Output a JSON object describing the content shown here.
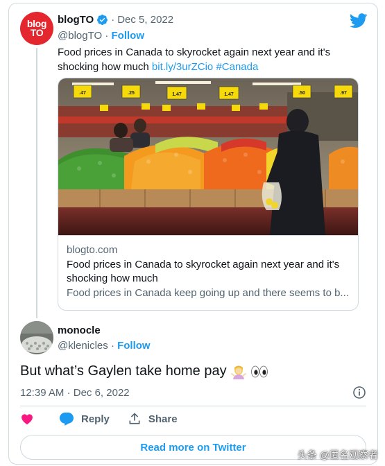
{
  "parent_tweet": {
    "avatar_text_line1": "blog",
    "avatar_text_line2": "TO",
    "display_name": "blogTO",
    "separator": "·",
    "date": "Dec 5, 2022",
    "handle": "@blogTO",
    "follow_label": "Follow",
    "text": "Food prices in Canada to skyrocket again next year and it's shocking how much ",
    "link_text": "bit.ly/3urZCio",
    "hashtag": "#Canada",
    "verified_icon": "verified-badge-icon"
  },
  "link_card": {
    "domain": "blogto.com",
    "title": "Food prices in Canada to skyrocket again next year and it's shocking how much",
    "description": "Food prices in Canada keep going up and there seems to b...",
    "price_tags": [
      ".47",
      ".25",
      "1.47",
      "1.47",
      ".50",
      ".97"
    ]
  },
  "reply_tweet": {
    "display_name": "monocle",
    "handle": "@klenicles",
    "separator": "·",
    "follow_label": "Follow",
    "text": "But what’s Gaylen take home pay",
    "emojis": [
      "person-shrugging-emoji",
      "eyes-emoji"
    ],
    "time": "12:39 AM",
    "date": "Dec 6, 2022",
    "actions": {
      "reply_label": "Reply",
      "share_label": "Share"
    },
    "read_more_label": "Read more on Twitter"
  },
  "watermark": {
    "text": "头条 @匿名观察者"
  },
  "colors": {
    "twitter_blue": "#1d9bf0",
    "like_pink": "#f91880",
    "blogto_red": "#e4262f",
    "muted_text": "#536471",
    "border": "#cfd9de"
  }
}
